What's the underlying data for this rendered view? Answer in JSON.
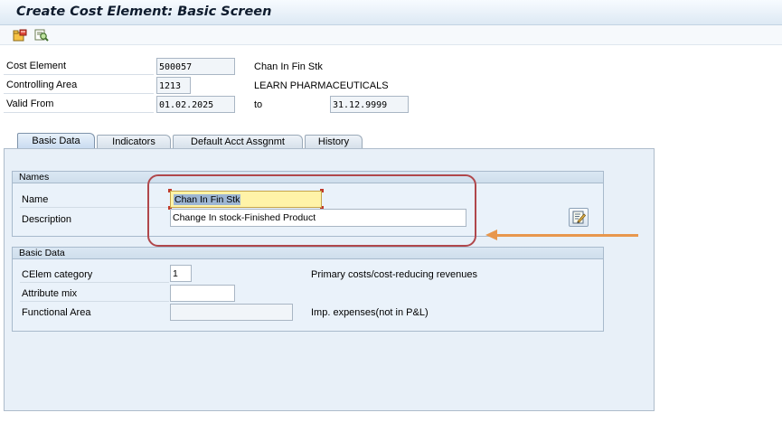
{
  "window": {
    "title": "Create Cost Element: Basic Screen"
  },
  "toolbar": {
    "icons": [
      "master-data-icon",
      "where-used-icon"
    ]
  },
  "header": {
    "cost_element_label": "Cost Element",
    "cost_element_value": "500057",
    "cost_element_desc": "Chan In Fin Stk",
    "controlling_area_label": "Controlling Area",
    "controlling_area_value": "1213",
    "controlling_area_desc": "LEARN PHARMACEUTICALS",
    "valid_from_label": "Valid From",
    "valid_from_value": "01.02.2025",
    "to_label": "to",
    "valid_to_value": "31.12.9999"
  },
  "tabs": [
    {
      "label": "Basic Data",
      "active": true
    },
    {
      "label": "Indicators",
      "active": false
    },
    {
      "label": "Default Acct Assgnmt",
      "active": false
    },
    {
      "label": "History",
      "active": false
    }
  ],
  "names_group": {
    "title": "Names",
    "name_label": "Name",
    "name_value": "Chan In Fin Stk",
    "description_label": "Description",
    "description_value": "Change In stock-Finished Product"
  },
  "basic_data_group": {
    "title": "Basic Data",
    "celem_category_label": "CElem category",
    "celem_category_value": "1",
    "celem_category_desc": "Primary costs/cost-reducing revenues",
    "attribute_mix_label": "Attribute mix",
    "attribute_mix_value": "",
    "functional_area_label": "Functional Area",
    "functional_area_value": "",
    "functional_area_desc": "Imp. expenses(not in P&L)"
  },
  "colors": {
    "annotation_box": "#b0474b",
    "annotation_arrow": "#e8974d",
    "focused_field": "#fff3a8",
    "panel_background": "#e8f0f8"
  }
}
